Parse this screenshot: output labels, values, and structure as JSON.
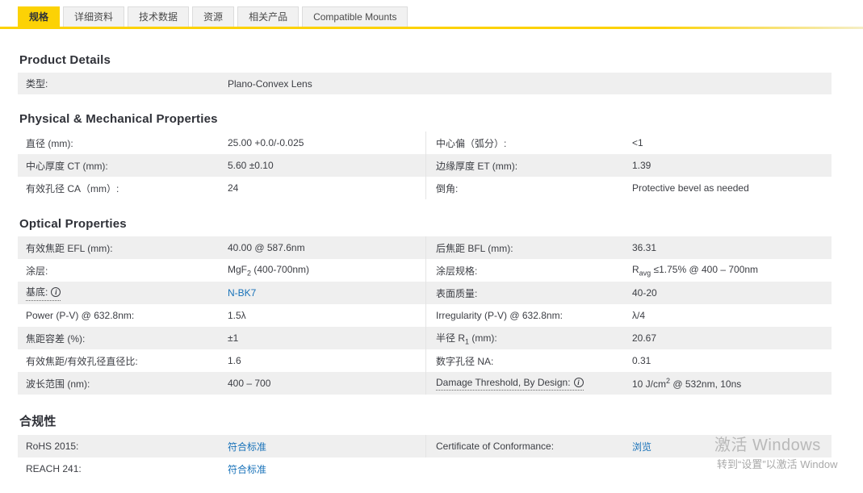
{
  "colors": {
    "accent_yellow": "#fcd205",
    "link_blue": "#1872b9",
    "row_shade": "#efefef"
  },
  "icons": {
    "info": "i"
  },
  "tabs": [
    {
      "label": "规格",
      "active": true
    },
    {
      "label": "详细资料",
      "active": false
    },
    {
      "label": "技术数据",
      "active": false
    },
    {
      "label": "资源",
      "active": false
    },
    {
      "label": "相关产品",
      "active": false
    },
    {
      "label": "Compatible Mounts",
      "active": false
    }
  ],
  "sections": [
    {
      "title": "Product Details",
      "rows": [
        {
          "left": {
            "label": "类型:",
            "value": "Plano-Convex Lens"
          }
        }
      ]
    },
    {
      "title": "Physical & Mechanical Properties",
      "rows": [
        {
          "left": {
            "label": "直径 (mm):",
            "value": "25.00 +0.0/-0.025"
          },
          "right": {
            "label": "中心偏（弧分）:",
            "value": "<1"
          }
        },
        {
          "left": {
            "label": "中心厚度 CT (mm):",
            "value": "5.60 ±0.10"
          },
          "right": {
            "label": "边缘厚度 ET (mm):",
            "value": "1.39"
          }
        },
        {
          "left": {
            "label": "有效孔径 CA（mm）:",
            "value": "24"
          },
          "right": {
            "label": "倒角:",
            "value": "Protective bevel as needed"
          }
        }
      ]
    },
    {
      "title": "Optical Properties",
      "rows": [
        {
          "left": {
            "label": "有效焦距 EFL (mm):",
            "value": "40.00 @ 587.6nm"
          },
          "right": {
            "label": "后焦距 BFL (mm):",
            "value": "36.31"
          }
        },
        {
          "left": {
            "label": "涂层:",
            "value_html": "MgF<sub>2</sub> (400-700nm)"
          },
          "right": {
            "label": "涂层规格:",
            "value_html": "R<sub>avg</sub> ≤1.75% @ 400 – 700nm"
          }
        },
        {
          "left": {
            "label": "基底:",
            "value": "N-BK7"
          },
          "right": {
            "label": "表面质量:",
            "value": "40-20"
          }
        },
        {
          "left": {
            "label": "Power (P-V) @ 632.8nm:",
            "value": "1.5λ"
          },
          "right": {
            "label": "Irregularity (P-V) @ 632.8nm:",
            "value": "λ/4"
          }
        },
        {
          "left": {
            "label": "焦距容差 (%):",
            "value": "±1"
          },
          "right": {
            "label_html": "半径 R<sub>1</sub> (mm):",
            "value": "20.67"
          }
        },
        {
          "left": {
            "label": "有效焦距/有效孔径直径比:",
            "value": "1.6"
          },
          "right": {
            "label": "数字孔径 NA:",
            "value": "0.31"
          }
        },
        {
          "left": {
            "label": "波长范围 (nm):",
            "value": "400 – 700"
          },
          "right": {
            "label": "Damage Threshold, By Design:",
            "value_html": "10 J/cm<sup>2</sup> @ 532nm, 10ns"
          }
        }
      ]
    },
    {
      "title": "合规性",
      "rows": [
        {
          "left": {
            "label": "RoHS 2015:",
            "value": "符合标准"
          },
          "right": {
            "label": "Certificate of Conformance:",
            "value": "浏览"
          }
        },
        {
          "left": {
            "label": "REACH 241:",
            "value": "符合标准"
          }
        }
      ]
    }
  ],
  "watermark": {
    "line1": "激活 Windows",
    "line2": "转到“设置”以激活 Window"
  }
}
